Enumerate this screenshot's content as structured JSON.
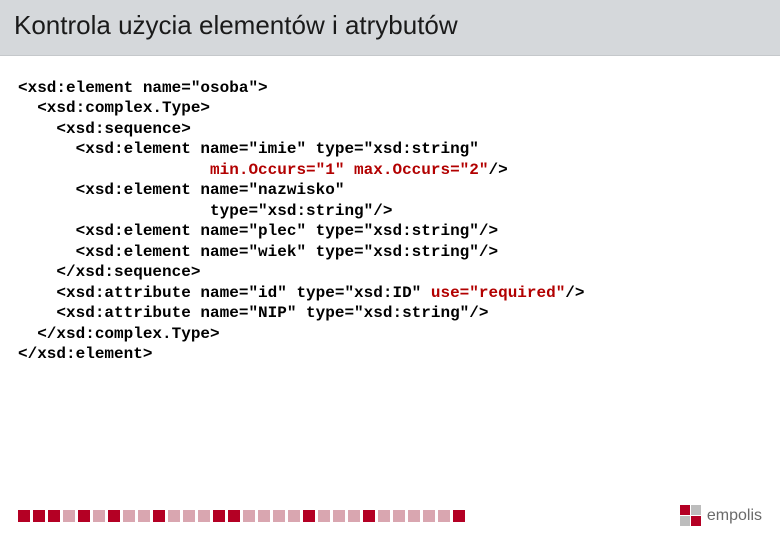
{
  "title": "Kontrola użycia elementów i atrybutów",
  "code": {
    "l1": "<xsd:element name=\"osoba\">",
    "l2": "  <xsd:complex.Type>",
    "l3": "    <xsd:sequence>",
    "l4a": "      <xsd:element name=\"imie\" type=\"xsd:string\"",
    "l4b_pre": "                    ",
    "l4b_hl": "min.Occurs=\"1\" max.Occurs=\"2\"",
    "l4b_post": "/>",
    "l5a": "      <xsd:element name=\"nazwisko\"",
    "l5b": "                    type=\"xsd:string\"/>",
    "l6": "      <xsd:element name=\"plec\" type=\"xsd:string\"/>",
    "l7": "      <xsd:element name=\"wiek\" type=\"xsd:string\"/>",
    "l8": "    </xsd:sequence>",
    "l9a": "    <xsd:attribute name=\"id\" type=\"xsd:ID\" ",
    "l9hl": "use=\"required\"",
    "l9b": "/>",
    "l10": "    <xsd:attribute name=\"NIP\" type=\"xsd:string\"/>",
    "l11": "  </xsd:complex.Type>",
    "l12": "</xsd:element>"
  },
  "footer": {
    "logo_text": "empolis",
    "squares": [
      "#b40024",
      "#b40024",
      "#b40024",
      "#d9a6b0",
      "#b40024",
      "#d9a6b0",
      "#b40024",
      "#d9a6b0",
      "#d9a6b0",
      "#b40024",
      "#d9a6b0",
      "#d9a6b0",
      "#d9a6b0",
      "#b40024",
      "#b40024",
      "#d9a6b0",
      "#d9a6b0",
      "#d9a6b0",
      "#d9a6b0",
      "#b40024",
      "#d9a6b0",
      "#d9a6b0",
      "#d9a6b0",
      "#b40024",
      "#d9a6b0",
      "#d9a6b0",
      "#d9a6b0",
      "#d9a6b0",
      "#d9a6b0",
      "#b40024"
    ]
  }
}
